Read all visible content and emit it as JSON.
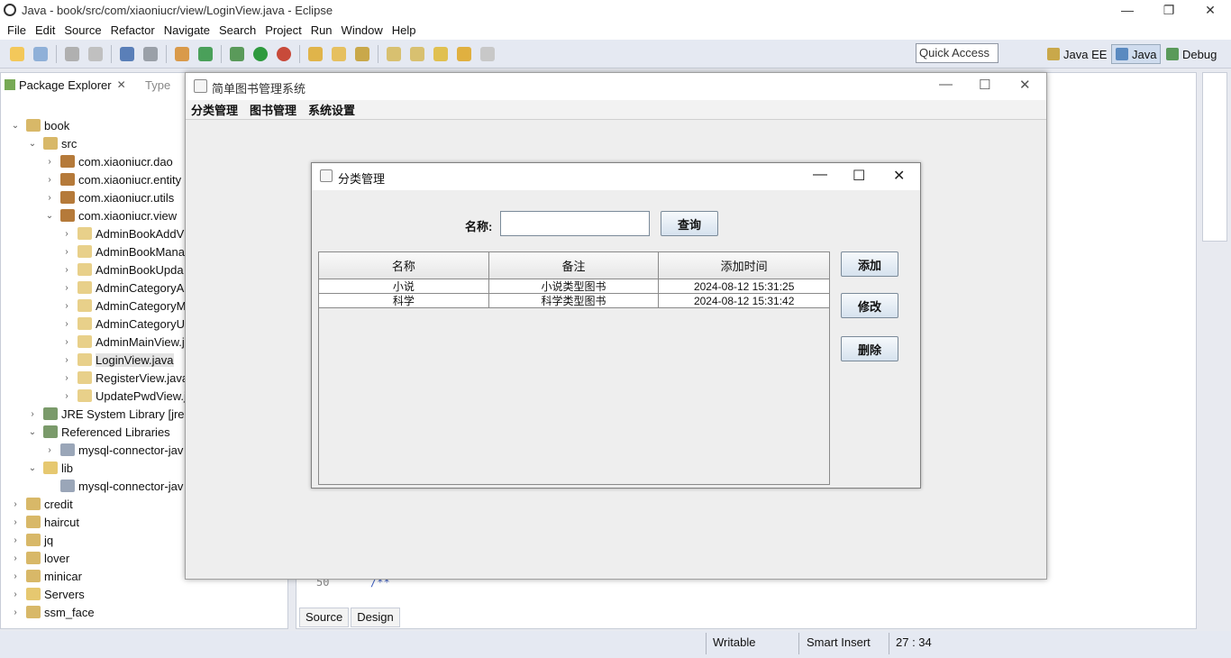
{
  "window": {
    "title": "Java - book/src/com/xiaoniucr/view/LoginView.java - Eclipse"
  },
  "menu": [
    "File",
    "Edit",
    "Source",
    "Refactor",
    "Navigate",
    "Search",
    "Project",
    "Run",
    "Window",
    "Help"
  ],
  "quick_access": {
    "placeholder": "Quick Access"
  },
  "perspectives": [
    "Java EE",
    "Java",
    "Debug"
  ],
  "package_explorer": {
    "tab": "Package Explorer",
    "tab2": "Type",
    "tree": [
      {
        "label": "book",
        "depth": 0,
        "arrow": "v",
        "icon": "project-icon"
      },
      {
        "label": "src",
        "depth": 1,
        "arrow": "v",
        "icon": "source-folder-icon"
      },
      {
        "label": "com.xiaoniucr.dao",
        "depth": 2,
        "arrow": ">",
        "icon": "package-icon"
      },
      {
        "label": "com.xiaoniucr.entity",
        "depth": 2,
        "arrow": ">",
        "icon": "package-icon"
      },
      {
        "label": "com.xiaoniucr.utils",
        "depth": 2,
        "arrow": ">",
        "icon": "package-icon"
      },
      {
        "label": "com.xiaoniucr.view",
        "depth": 2,
        "arrow": "v",
        "icon": "package-icon"
      },
      {
        "label": "AdminBookAddV",
        "depth": 3,
        "arrow": ">",
        "icon": "java-file-icon"
      },
      {
        "label": "AdminBookMana",
        "depth": 3,
        "arrow": ">",
        "icon": "java-file-icon"
      },
      {
        "label": "AdminBookUpda",
        "depth": 3,
        "arrow": ">",
        "icon": "java-file-icon"
      },
      {
        "label": "AdminCategoryA",
        "depth": 3,
        "arrow": ">",
        "icon": "java-file-icon"
      },
      {
        "label": "AdminCategoryM",
        "depth": 3,
        "arrow": ">",
        "icon": "java-file-icon"
      },
      {
        "label": "AdminCategoryU",
        "depth": 3,
        "arrow": ">",
        "icon": "java-file-icon"
      },
      {
        "label": "AdminMainView.j",
        "depth": 3,
        "arrow": ">",
        "icon": "java-file-icon"
      },
      {
        "label": "LoginView.java",
        "depth": 3,
        "arrow": ">",
        "icon": "java-file-icon",
        "selected": true
      },
      {
        "label": "RegisterView.java",
        "depth": 3,
        "arrow": ">",
        "icon": "java-file-icon"
      },
      {
        "label": "UpdatePwdView.j",
        "depth": 3,
        "arrow": ">",
        "icon": "java-file-icon"
      },
      {
        "label": "JRE System Library [jre1",
        "depth": 1,
        "arrow": ">",
        "icon": "library-icon"
      },
      {
        "label": "Referenced Libraries",
        "depth": 1,
        "arrow": "v",
        "icon": "library-icon"
      },
      {
        "label": "mysql-connector-jav",
        "depth": 2,
        "arrow": ">",
        "icon": "jar-icon"
      },
      {
        "label": "lib",
        "depth": 1,
        "arrow": "v",
        "icon": "folder-icon"
      },
      {
        "label": "mysql-connector-jav",
        "depth": 2,
        "arrow": "",
        "icon": "jar-icon"
      },
      {
        "label": "credit",
        "depth": 0,
        "arrow": ">",
        "icon": "project-icon"
      },
      {
        "label": "haircut",
        "depth": 0,
        "arrow": ">",
        "icon": "project-icon"
      },
      {
        "label": "jq",
        "depth": 0,
        "arrow": ">",
        "icon": "project-icon"
      },
      {
        "label": "lover",
        "depth": 0,
        "arrow": ">",
        "icon": "project-icon"
      },
      {
        "label": "minicar",
        "depth": 0,
        "arrow": ">",
        "icon": "project-icon"
      },
      {
        "label": "Servers",
        "depth": 0,
        "arrow": ">",
        "icon": "folder-icon"
      },
      {
        "label": "ssm_face",
        "depth": 0,
        "arrow": ">",
        "icon": "project-icon"
      }
    ]
  },
  "editor": {
    "line_number": "50",
    "code": "/**",
    "tabs": [
      "Source",
      "Design"
    ]
  },
  "status": {
    "writable": "Writable",
    "insert": "Smart Insert",
    "position": "27 : 34"
  },
  "app_window": {
    "title": "简单图书管理系统",
    "menu": [
      "分类管理",
      "图书管理",
      "系统设置"
    ]
  },
  "dialog": {
    "title": "分类管理",
    "search_label": "名称:",
    "search_value": "",
    "query_button": "查询",
    "add_button": "添加",
    "edit_button": "修改",
    "delete_button": "删除",
    "table": {
      "headers": [
        "名称",
        "备注",
        "添加时间"
      ],
      "rows": [
        [
          "小说",
          "小说类型图书",
          "2024-08-12 15:31:25"
        ],
        [
          "科学",
          "科学类型图书",
          "2024-08-12 15:31:42"
        ]
      ]
    }
  },
  "colors": {
    "accent": "#3c8fd6",
    "window_bg": "#eeeeee",
    "toolbar_bg": "#e5e9f2"
  }
}
